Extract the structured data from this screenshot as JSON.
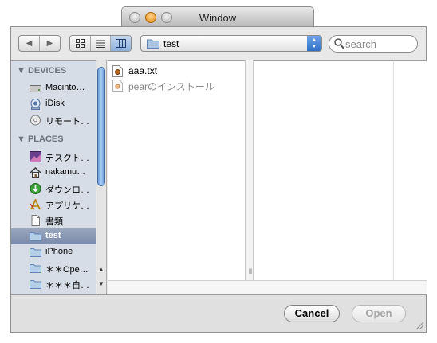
{
  "window": {
    "title": "Window"
  },
  "toolbar": {
    "back_label": "◀",
    "forward_label": "▶",
    "location": "test",
    "search_placeholder": "search"
  },
  "sidebar": {
    "devices_header": "▼ DEVICES",
    "devices": [
      {
        "label": "Macinto…",
        "icon": "hard-disk-icon"
      },
      {
        "label": "iDisk",
        "icon": "idisk-icon"
      },
      {
        "label": "リモート…",
        "icon": "remote-disc-icon"
      }
    ],
    "places_header": "▼ PLACES",
    "places": [
      {
        "label": "デスクト…",
        "icon": "desktop-icon"
      },
      {
        "label": "nakamu…",
        "icon": "home-icon"
      },
      {
        "label": "ダウンロ…",
        "icon": "downloads-icon"
      },
      {
        "label": "アプリケ…",
        "icon": "applications-icon"
      },
      {
        "label": "書類",
        "icon": "documents-icon"
      },
      {
        "label": "test",
        "icon": "folder-icon",
        "selected": true
      },
      {
        "label": "iPhone",
        "icon": "folder-icon"
      },
      {
        "label": "＊＊Ope…",
        "icon": "folder-icon"
      },
      {
        "label": "＊＊＊自…",
        "icon": "folder-icon"
      }
    ]
  },
  "files": [
    {
      "name": "aaa.txt",
      "icon": "text-file-icon",
      "enabled": true
    },
    {
      "name": "pearのインストール",
      "icon": "document-icon",
      "enabled": false
    }
  ],
  "buttons": {
    "cancel": "Cancel",
    "open": "Open"
  }
}
